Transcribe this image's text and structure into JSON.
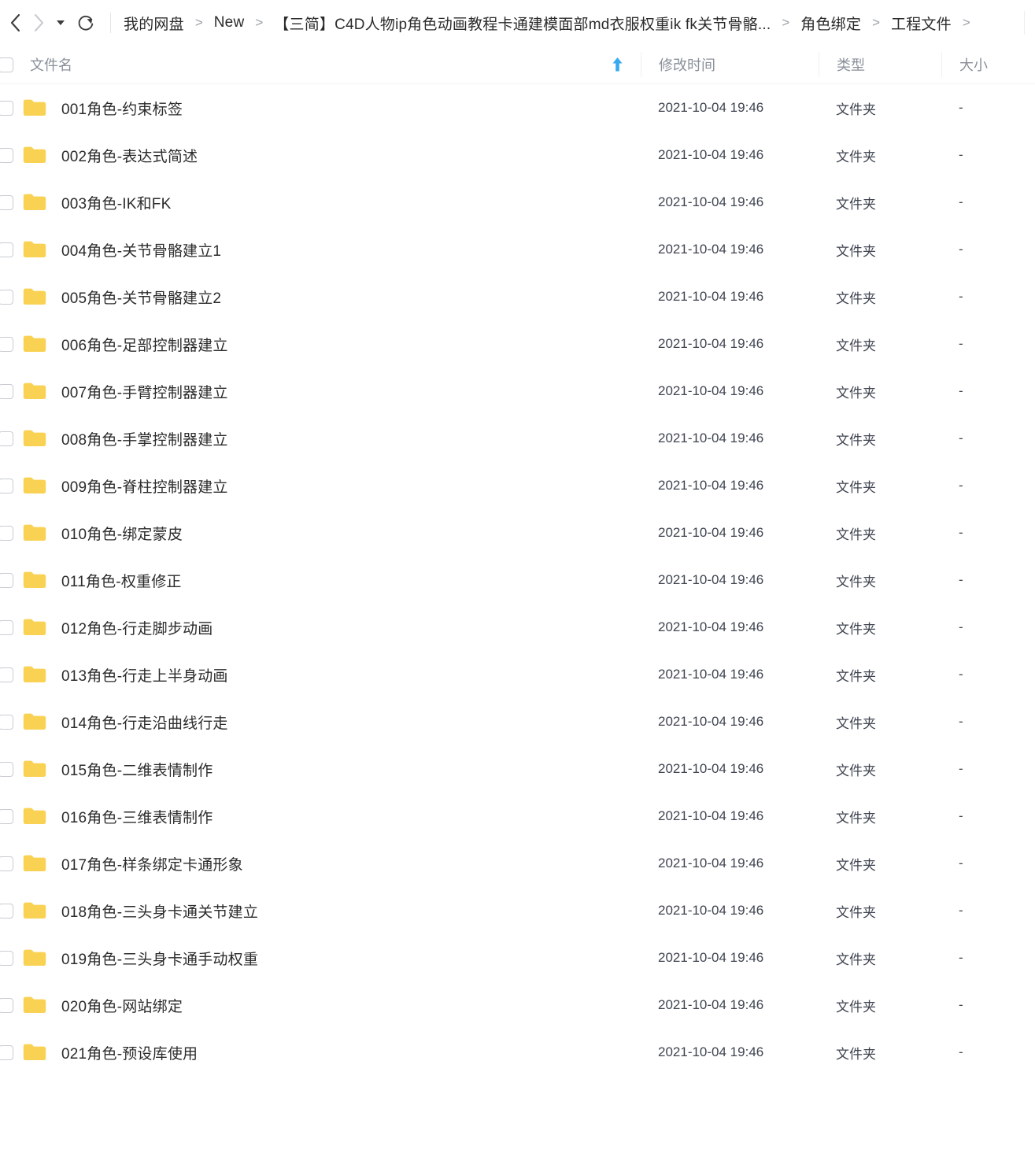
{
  "toolbar": {
    "back_icon": "chevron-left-icon",
    "forward_icon": "chevron-right-icon",
    "dropdown_icon": "caret-down-icon",
    "refresh_icon": "refresh-icon",
    "breadcrumb": [
      "我的网盘",
      "New",
      "【三简】C4D人物ip角色动画教程卡通建模面部md衣服权重ik fk关节骨骼...",
      "角色绑定",
      "工程文件"
    ],
    "separator": ">"
  },
  "columns": {
    "name": "文件名",
    "date": "修改时间",
    "type": "类型",
    "size": "大小",
    "sort_icon": "sort-ascending-arrow-icon",
    "sort_direction": "ascending",
    "select_all_checkbox": "unchecked"
  },
  "colors": {
    "folder": "#F9D254",
    "folder_tab": "#FACE4B",
    "sort_arrow": "#36A9F0",
    "text_primary": "#2b2b2b",
    "text_secondary": "#3f4450",
    "header_text": "#8a9099",
    "border": "#edeff2",
    "background": "#ffffff"
  },
  "files": [
    {
      "name": "001角色-约束标签",
      "date": "2021-10-04 19:46",
      "type": "文件夹",
      "size": "-"
    },
    {
      "name": "002角色-表达式简述",
      "date": "2021-10-04 19:46",
      "type": "文件夹",
      "size": "-"
    },
    {
      "name": "003角色-IK和FK",
      "date": "2021-10-04 19:46",
      "type": "文件夹",
      "size": "-"
    },
    {
      "name": "004角色-关节骨骼建立1",
      "date": "2021-10-04 19:46",
      "type": "文件夹",
      "size": "-"
    },
    {
      "name": "005角色-关节骨骼建立2",
      "date": "2021-10-04 19:46",
      "type": "文件夹",
      "size": "-"
    },
    {
      "name": "006角色-足部控制器建立",
      "date": "2021-10-04 19:46",
      "type": "文件夹",
      "size": "-"
    },
    {
      "name": "007角色-手臂控制器建立",
      "date": "2021-10-04 19:46",
      "type": "文件夹",
      "size": "-"
    },
    {
      "name": "008角色-手掌控制器建立",
      "date": "2021-10-04 19:46",
      "type": "文件夹",
      "size": "-"
    },
    {
      "name": "009角色-脊柱控制器建立",
      "date": "2021-10-04 19:46",
      "type": "文件夹",
      "size": "-"
    },
    {
      "name": "010角色-绑定蒙皮",
      "date": "2021-10-04 19:46",
      "type": "文件夹",
      "size": "-"
    },
    {
      "name": "011角色-权重修正",
      "date": "2021-10-04 19:46",
      "type": "文件夹",
      "size": "-"
    },
    {
      "name": "012角色-行走脚步动画",
      "date": "2021-10-04 19:46",
      "type": "文件夹",
      "size": "-"
    },
    {
      "name": "013角色-行走上半身动画",
      "date": "2021-10-04 19:46",
      "type": "文件夹",
      "size": "-"
    },
    {
      "name": "014角色-行走沿曲线行走",
      "date": "2021-10-04 19:46",
      "type": "文件夹",
      "size": "-"
    },
    {
      "name": "015角色-二维表情制作",
      "date": "2021-10-04 19:46",
      "type": "文件夹",
      "size": "-"
    },
    {
      "name": "016角色-三维表情制作",
      "date": "2021-10-04 19:46",
      "type": "文件夹",
      "size": "-"
    },
    {
      "name": "017角色-样条绑定卡通形象",
      "date": "2021-10-04 19:46",
      "type": "文件夹",
      "size": "-"
    },
    {
      "name": "018角色-三头身卡通关节建立",
      "date": "2021-10-04 19:46",
      "type": "文件夹",
      "size": "-"
    },
    {
      "name": "019角色-三头身卡通手动权重",
      "date": "2021-10-04 19:46",
      "type": "文件夹",
      "size": "-"
    },
    {
      "name": "020角色-网站绑定",
      "date": "2021-10-04 19:46",
      "type": "文件夹",
      "size": "-"
    },
    {
      "name": "021角色-预设库使用",
      "date": "2021-10-04 19:46",
      "type": "文件夹",
      "size": "-"
    }
  ]
}
